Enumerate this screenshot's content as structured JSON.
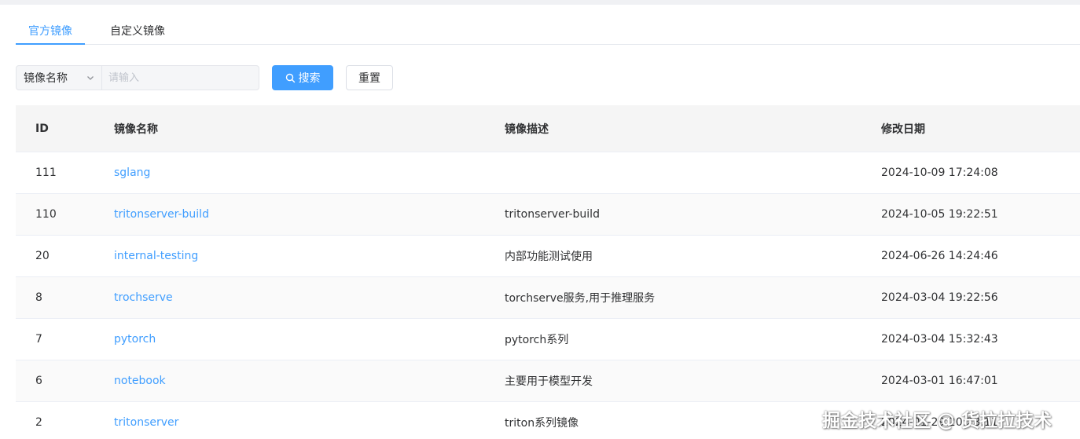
{
  "tabs": [
    {
      "label": "官方镜像",
      "active": true
    },
    {
      "label": "自定义镜像",
      "active": false
    }
  ],
  "search": {
    "field_selected": "镜像名称",
    "placeholder": "请输入",
    "value": "",
    "search_button": "搜索",
    "reset_button": "重置"
  },
  "table": {
    "headers": {
      "id": "ID",
      "name": "镜像名称",
      "desc": "镜像描述",
      "date": "修改日期"
    },
    "rows": [
      {
        "id": "111",
        "name": "sglang",
        "desc": "",
        "date": "2024-10-09 17:24:08"
      },
      {
        "id": "110",
        "name": "tritonserver-build",
        "desc": "tritonserver-build",
        "date": "2024-10-05 19:22:51"
      },
      {
        "id": "20",
        "name": "internal-testing",
        "desc": "内部功能测试使用",
        "date": "2024-06-26 14:24:46"
      },
      {
        "id": "8",
        "name": "trochserve",
        "desc": "torchserve服务,用于推理服务",
        "date": "2024-03-04 19:22:56"
      },
      {
        "id": "7",
        "name": "pytorch",
        "desc": "pytorch系列",
        "date": "2024-03-04 15:32:43"
      },
      {
        "id": "6",
        "name": "notebook",
        "desc": "主要用于模型开发",
        "date": "2024-03-01 16:47:01"
      },
      {
        "id": "2",
        "name": "tritonserver",
        "desc": "triton系列镜像",
        "date": "2024-01-29 20:28:11"
      }
    ]
  },
  "watermark": "掘金技术社区 @ 货拉拉技术",
  "icons": {
    "search": "search-icon",
    "select_arrow": "chevron-down-icon"
  },
  "colors": {
    "accent": "#409eff",
    "header_bg": "#f5f5f5"
  }
}
